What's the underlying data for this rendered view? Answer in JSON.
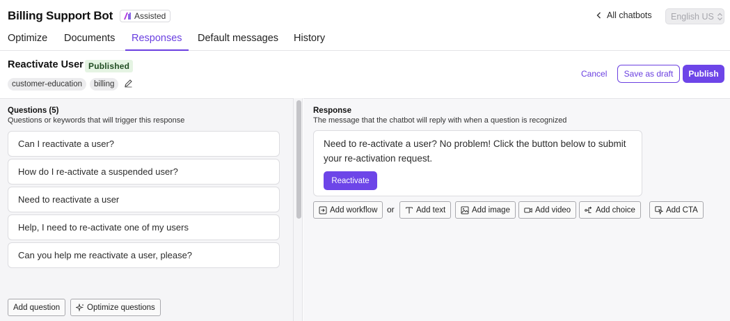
{
  "header": {
    "app_title": "Billing Support Bot",
    "assisted_badge": "Assisted",
    "back_link": "All chatbots",
    "language": "English US"
  },
  "tabs": [
    {
      "label": "Optimize",
      "active": false
    },
    {
      "label": "Documents",
      "active": false
    },
    {
      "label": "Responses",
      "active": true
    },
    {
      "label": "Default messages",
      "active": false
    },
    {
      "label": "History",
      "active": false
    }
  ],
  "response_header": {
    "title": "Reactivate User",
    "status": "Published",
    "tags": [
      "customer-education",
      "billing"
    ],
    "cancel_label": "Cancel",
    "save_draft_label": "Save as draft",
    "publish_label": "Publish"
  },
  "questions_panel": {
    "title": "Questions (5)",
    "subtitle": "Questions or keywords that will trigger this response",
    "questions": [
      "Can I reactivate a user?",
      "How do I re-activate a suspended user?",
      "Need to reactivate a user",
      "Help, I need to re-activate one of my users",
      "Can you help me reactivate a user, please?"
    ],
    "add_question_label": "Add question",
    "optimize_questions_label": "Optimize questions"
  },
  "response_panel": {
    "title": "Response",
    "subtitle": "The message that the chatbot will reply with when a question is recognized",
    "message": "Need to re-activate a user? No problem! Click the button below to submit your re-activation request.",
    "cta_button_label": "Reactivate",
    "add_workflow_label": "Add workflow",
    "or_label": "or",
    "add_text_label": "Add text",
    "add_image_label": "Add image",
    "add_video_label": "Add video",
    "add_choice_label": "Add choice",
    "add_cta_label": "Add CTA"
  },
  "colors": {
    "accent": "#6d45e8",
    "published_bg": "#e5f4e3",
    "panel_bg": "#f5f5f7"
  }
}
